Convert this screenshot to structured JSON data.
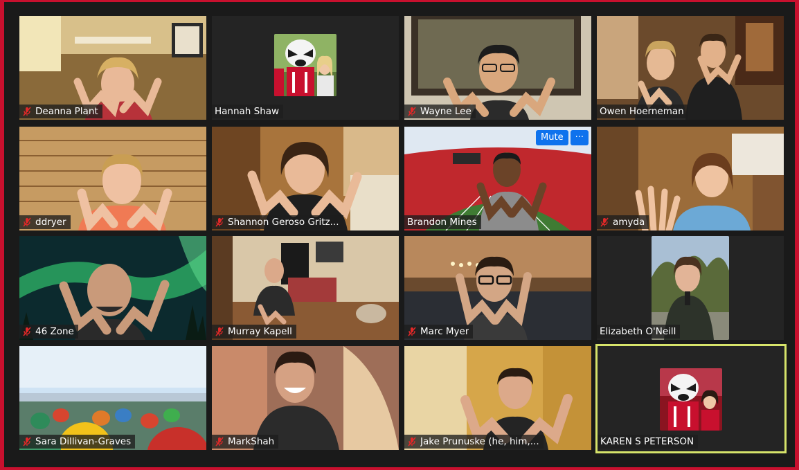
{
  "app": "Zoom meeting gallery view",
  "colors": {
    "accent_border": "#c8102e",
    "active_speaker": "#d6e36a",
    "button_blue": "#0e72ed",
    "muted_icon": "#e02828"
  },
  "hover_controls": {
    "mute_label": "Mute",
    "more_label": "···"
  },
  "participants": [
    {
      "name": "Deanna Plant",
      "muted": true
    },
    {
      "name": "Hannah Shaw",
      "muted": false,
      "avatar": true
    },
    {
      "name": "Wayne Lee",
      "muted": true
    },
    {
      "name": "Owen Hoerneman",
      "muted": false
    },
    {
      "name": "ddryer",
      "muted": true
    },
    {
      "name": "Shannon Geroso Gritz...",
      "muted": true
    },
    {
      "name": "Brandon Mines",
      "muted": false,
      "hovered": true
    },
    {
      "name": "amyda",
      "muted": true
    },
    {
      "name": "46 Zone",
      "muted": true
    },
    {
      "name": "Murray Kapell",
      "muted": true
    },
    {
      "name": "Marc Myer",
      "muted": true
    },
    {
      "name": "Elizabeth O'Neill",
      "muted": false,
      "avatar": true
    },
    {
      "name": "Sara Dillivan-Graves",
      "muted": true
    },
    {
      "name": "MarkShah",
      "muted": true
    },
    {
      "name": "Jake Prunuske (he, him,...",
      "muted": true
    },
    {
      "name": "KAREN S PETERSON",
      "muted": false,
      "avatar": true,
      "active_speaker": true
    }
  ]
}
